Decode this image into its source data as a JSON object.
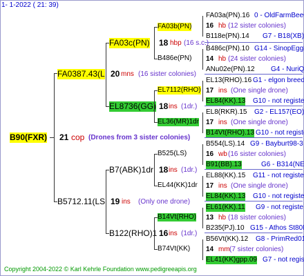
{
  "header": "1-   1-2022 ( 21: 39)",
  "root": {
    "name": "B90(FXR)",
    "num": "21",
    "unit": "cop",
    "note": "(Drones from 3 sister colonies)"
  },
  "sire": {
    "name": "FA0387.43(L",
    "num": "20",
    "unit": "mns",
    "note": "(16 sister colonies)"
  },
  "dam": {
    "name": "B5712.11(LS",
    "num": "19",
    "unit": "ins",
    "note": "(Only one drone)"
  },
  "gen2": [
    {
      "name": "FA03c(PN)",
      "num": "18",
      "unit": "hbp",
      "note": "(16 s.c.)"
    },
    {
      "name": "EL8736(GG)",
      "num": "18",
      "unit": "ins",
      "note": "(1dr.)"
    },
    {
      "name": "B7(ABK)1dr",
      "num": "18",
      "unit": "ins",
      "note": "(1dr.)"
    },
    {
      "name": "B122(RHO)1",
      "num": "16",
      "unit": "ins",
      "note": "(1dr.)"
    }
  ],
  "gen3": [
    {
      "name": "FA03b(PN)",
      "num": "16",
      "unit": "hb"
    },
    {
      "name": "B486e(PN)",
      "num": "14",
      "unit": "hb"
    },
    {
      "name": "EL7112(RHO)",
      "num": "17",
      "unit": "ins"
    },
    {
      "name": "EL36(MR)1dr",
      "num": "17",
      "unit": "ins"
    },
    {
      "name": "B525(LS)",
      "num": "16",
      "unit": "wb"
    },
    {
      "name": "EL44(KK)1dr",
      "num": "17",
      "unit": "ins"
    },
    {
      "name": "B14Vt(RHO)",
      "num": "13",
      "unit": "hb"
    },
    {
      "name": "B74Vt(KK)",
      "num": "14",
      "unit": "mm"
    }
  ],
  "gen4": [
    {
      "name": "FA03a(PN).16",
      "code": "0 - OldFarmBeeQ"
    },
    {
      "name": "16",
      "unit": "hb",
      "note": "(12 sister colonies)"
    },
    {
      "name": "B118e(PN).14",
      "code": "G7 - B18(XB)"
    },
    {
      "name": "B486c(PN).10",
      "code": "G14 - SinopEgg86R"
    },
    {
      "name": "14",
      "unit": "hb",
      "note": "(24 sister colonies)"
    },
    {
      "name": "ANu02e(PN).12",
      "code": "G4 - NuriQ"
    },
    {
      "name": "EL13(RHO).16",
      "code": "G1 - elgon breed"
    },
    {
      "name": "17",
      "unit": "ins",
      "note": "(One single drone)"
    },
    {
      "name": "EL84(KK).13",
      "code": "G10 - not registe"
    },
    {
      "name": "EL8(RKR).15",
      "code": "G2 - EL157(EO)"
    },
    {
      "name": "17",
      "unit": "ins",
      "note": "(One single drone)"
    },
    {
      "name": "B14Vt(RHO).13",
      "code": "G10 - not registe"
    },
    {
      "name": "B554(LS).14",
      "code": "G9 - Bayburt98-3"
    },
    {
      "name": "16",
      "unit": "wb",
      "note": "(16 sister colonies)"
    },
    {
      "name": "B91(BB).13",
      "code": "G6 - B314(NE)"
    },
    {
      "name": "EL88(KK).15",
      "code": "G11 - not registe"
    },
    {
      "name": "17",
      "unit": "ins",
      "note": "(One single drone)"
    },
    {
      "name": "EL84(KK).13",
      "code": "G10 - not registe"
    },
    {
      "name": "EL61(KK).11",
      "code": "G9 - not registe"
    },
    {
      "name": "13",
      "unit": "hb",
      "note": "(18 sister colonies)"
    },
    {
      "name": "B235(PJ).10",
      "code": "G15 - Athos St80R"
    },
    {
      "name": "B56Vt(KK).12",
      "code": "G8 - PrimRed01"
    },
    {
      "name": "14",
      "unit": "mm",
      "note": "(7 sister colonies)"
    },
    {
      "name": "EL41(KK)gpp.09",
      "code": "G7 - not registe"
    }
  ],
  "footer": "Copyright 2004-2022 © Karl Kehrle Foundation    www.pedigreeapis.org"
}
